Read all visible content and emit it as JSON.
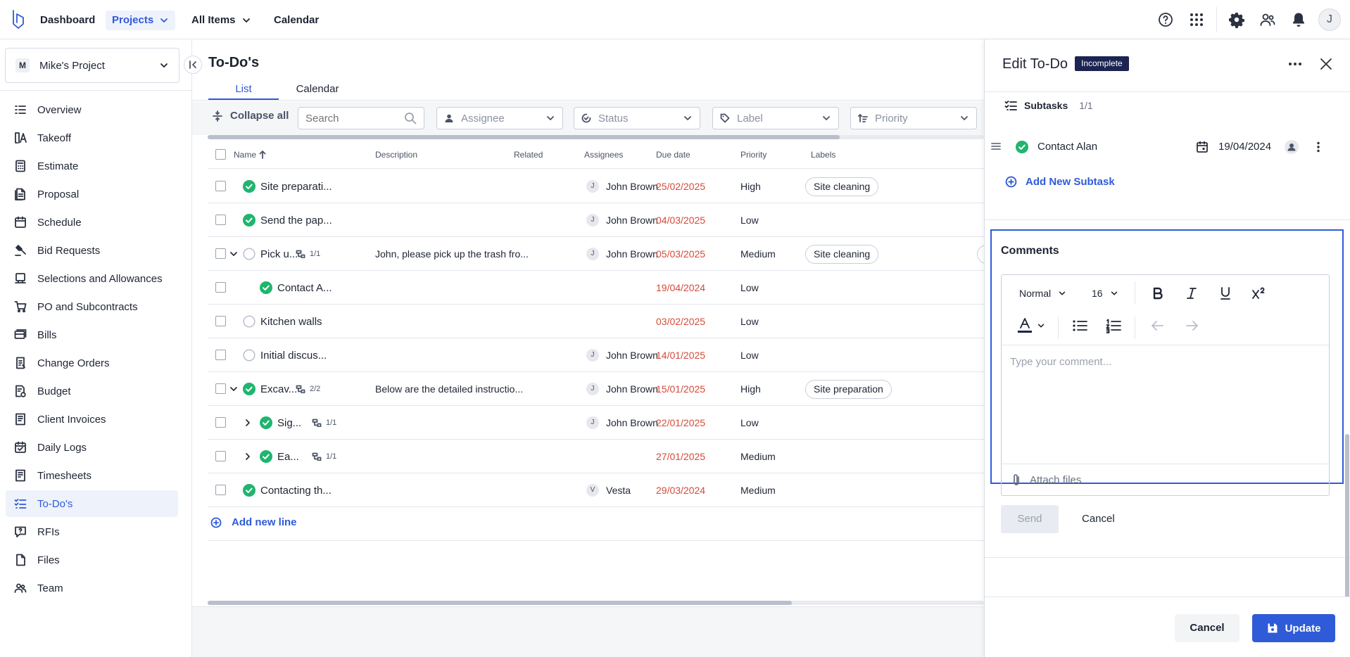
{
  "nav": {
    "dashboard": "Dashboard",
    "projects": "Projects",
    "all_items": "All Items",
    "calendar": "Calendar",
    "avatar_initial": "J"
  },
  "icons": {
    "help": "help-circle-icon",
    "apps": "apps-grid-icon",
    "settings": "gear-icon",
    "users": "users-icon",
    "notifications": "bell-icon"
  },
  "colors": {
    "accent": "#2f5bd8",
    "due_red": "#d64a3a",
    "success": "#1fb56e",
    "badge_bg": "#1c2452"
  },
  "sidebar": {
    "project_initial": "M",
    "project_name": "Mike's Project",
    "items": [
      {
        "label": "Overview",
        "icon": "list-icon"
      },
      {
        "label": "Takeoff",
        "icon": "ruler-icon"
      },
      {
        "label": "Estimate",
        "icon": "calculator-icon"
      },
      {
        "label": "Proposal",
        "icon": "document-icon"
      },
      {
        "label": "Schedule",
        "icon": "calendar-icon"
      },
      {
        "label": "Bid Requests",
        "icon": "gavel-icon"
      },
      {
        "label": "Selections and Allowances",
        "icon": "selection-icon"
      },
      {
        "label": "PO and Subcontracts",
        "icon": "cart-icon"
      },
      {
        "label": "Bills",
        "icon": "bills-icon"
      },
      {
        "label": "Change Orders",
        "icon": "change-icon"
      },
      {
        "label": "Budget",
        "icon": "budget-icon"
      },
      {
        "label": "Client Invoices",
        "icon": "invoice-icon"
      },
      {
        "label": "Daily Logs",
        "icon": "daily-log-icon"
      },
      {
        "label": "Timesheets",
        "icon": "timesheet-icon"
      },
      {
        "label": "To-Do's",
        "icon": "todo-icon"
      },
      {
        "label": "RFIs",
        "icon": "rfi-icon"
      },
      {
        "label": "Files",
        "icon": "file-icon"
      },
      {
        "label": "Team",
        "icon": "team-icon"
      }
    ]
  },
  "main": {
    "title": "To-Do's",
    "tabs": [
      "List",
      "Calendar"
    ],
    "collapse_all": "Collapse all",
    "filters": {
      "search_placeholder": "Search",
      "assignee": "Assignee",
      "status": "Status",
      "label": "Label",
      "priority": "Priority"
    },
    "columns": [
      "Name",
      "Description",
      "Related",
      "Assignees",
      "Due date",
      "Priority",
      "Labels"
    ],
    "rows": [
      {
        "name": "Site preparati...",
        "status": "done",
        "indent": 0,
        "expand": "",
        "subtasks": "",
        "description": "",
        "assignee_initial": "J",
        "assignee": "John Brown",
        "due": "25/02/2025",
        "priority": "High",
        "label": "Site cleaning"
      },
      {
        "name": "Send the pap...",
        "status": "done",
        "indent": 0,
        "expand": "",
        "subtasks": "",
        "description": "",
        "assignee_initial": "J",
        "assignee": "John Brown",
        "due": "04/03/2025",
        "priority": "Low",
        "label": ""
      },
      {
        "name": "Pick u...",
        "status": "open",
        "indent": 0,
        "expand": "down",
        "subtasks": "1/1",
        "description": "John, please pick up the trash fro...",
        "assignee_initial": "J",
        "assignee": "John Brown",
        "due": "05/03/2025",
        "priority": "Medium",
        "label": "Site cleaning"
      },
      {
        "name": "Contact A...",
        "status": "done",
        "indent": 1,
        "expand": "",
        "subtasks": "",
        "description": "",
        "assignee_initial": "",
        "assignee": "",
        "due": "19/04/2024",
        "priority": "Low",
        "label": ""
      },
      {
        "name": "Kitchen walls",
        "status": "open",
        "indent": 0,
        "expand": "",
        "subtasks": "",
        "description": "",
        "assignee_initial": "",
        "assignee": "",
        "due": "03/02/2025",
        "priority": "Low",
        "label": ""
      },
      {
        "name": "Initial discus...",
        "status": "open",
        "indent": 0,
        "expand": "",
        "subtasks": "",
        "description": "",
        "assignee_initial": "J",
        "assignee": "John Brown",
        "due": "14/01/2025",
        "priority": "Low",
        "label": ""
      },
      {
        "name": "Excav...",
        "status": "done",
        "indent": 0,
        "expand": "down",
        "subtasks": "2/2",
        "description": "Below are the detailed instructio...",
        "assignee_initial": "J",
        "assignee": "John Brown",
        "due": "15/01/2025",
        "priority": "High",
        "label": "Site preparation"
      },
      {
        "name": "Sig...",
        "status": "done",
        "indent": 1,
        "expand": "right",
        "subtasks": "1/1",
        "description": "",
        "assignee_initial": "J",
        "assignee": "John Brown",
        "due": "22/01/2025",
        "priority": "Low",
        "label": ""
      },
      {
        "name": "Ea...",
        "status": "done",
        "indent": 1,
        "expand": "right",
        "subtasks": "1/1",
        "description": "",
        "assignee_initial": "",
        "assignee": "",
        "due": "27/01/2025",
        "priority": "Medium",
        "label": ""
      },
      {
        "name": "Contacting th...",
        "status": "done",
        "indent": 0,
        "expand": "",
        "subtasks": "",
        "description": "",
        "assignee_initial": "V",
        "assignee": "Vesta",
        "due": "29/03/2024",
        "priority": "Medium",
        "label": ""
      }
    ],
    "add_new_line": "Add new line"
  },
  "panel": {
    "title": "Edit To-Do",
    "status_badge": "Incomplete",
    "subtasks_label": "Subtasks",
    "subtasks_count": "1/1",
    "subtask": {
      "name": "Contact Alan",
      "date": "19/04/2024"
    },
    "add_subtask": "Add New Subtask",
    "comments": {
      "title": "Comments",
      "text_style": "Normal",
      "font_size": "16",
      "placeholder": "Type your comment...",
      "attach": "Attach files",
      "send": "Send",
      "cancel": "Cancel"
    },
    "footer": {
      "cancel": "Cancel",
      "update": "Update"
    }
  }
}
